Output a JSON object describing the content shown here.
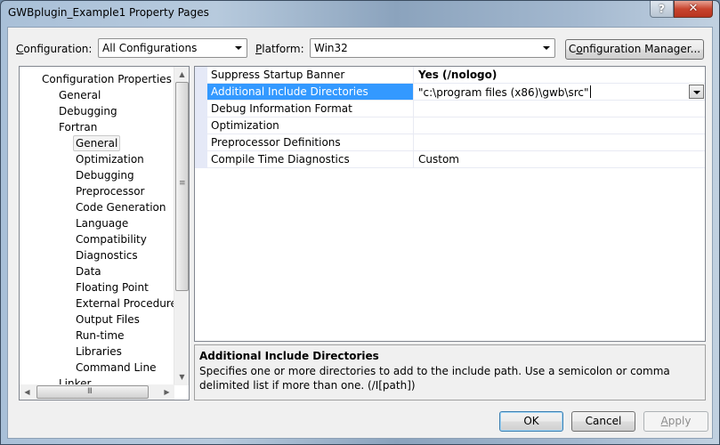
{
  "window": {
    "title": "GWBplugin_Example1 Property Pages",
    "help_button": "?",
    "close_button": "✕"
  },
  "toolbar": {
    "configuration_label_prefix": "",
    "configuration_label_accel": "C",
    "configuration_label_rest": "onfiguration:",
    "configuration_value": "All Configurations",
    "platform_label_accel": "P",
    "platform_label_rest": "latform:",
    "platform_value": "Win32",
    "config_manager_pre": "C",
    "config_manager_accel": "o",
    "config_manager_rest": "nfiguration Manager..."
  },
  "tree": {
    "items": [
      {
        "label": "Configuration Properties",
        "level": 0
      },
      {
        "label": "General",
        "level": 1
      },
      {
        "label": "Debugging",
        "level": 1
      },
      {
        "label": "Fortran",
        "level": 1
      },
      {
        "label": "General",
        "level": 2,
        "selected": true
      },
      {
        "label": "Optimization",
        "level": 2
      },
      {
        "label": "Debugging",
        "level": 2
      },
      {
        "label": "Preprocessor",
        "level": 2
      },
      {
        "label": "Code Generation",
        "level": 2
      },
      {
        "label": "Language",
        "level": 2
      },
      {
        "label": "Compatibility",
        "level": 2
      },
      {
        "label": "Diagnostics",
        "level": 2
      },
      {
        "label": "Data",
        "level": 2
      },
      {
        "label": "Floating Point",
        "level": 2
      },
      {
        "label": "External Procedures",
        "level": 2
      },
      {
        "label": "Output Files",
        "level": 2
      },
      {
        "label": "Run-time",
        "level": 2
      },
      {
        "label": "Libraries",
        "level": 2
      },
      {
        "label": "Command Line",
        "level": 2
      },
      {
        "label": "Linker",
        "level": 1
      }
    ],
    "scroll_up": "▲",
    "scroll_down": "▼",
    "scroll_left": "◀",
    "scroll_right": "▶",
    "vgrip": "≡",
    "hgrip": "III"
  },
  "properties": {
    "rows": [
      {
        "name": "Suppress Startup Banner",
        "value": "Yes (/nologo)",
        "bold": true
      },
      {
        "name": "Additional Include Directories",
        "value": "\"c:\\program files (x86)\\gwb\\src\"",
        "selected": true,
        "editing": true
      },
      {
        "name": "Debug Information Format",
        "value": ""
      },
      {
        "name": "Optimization",
        "value": ""
      },
      {
        "name": "Preprocessor Definitions",
        "value": ""
      },
      {
        "name": "Compile Time Diagnostics",
        "value": "Custom"
      }
    ]
  },
  "description": {
    "title": "Additional Include Directories",
    "text": "Specifies one or more directories to add to the include path. Use a semicolon or comma delimited list if more than one. (/I[path])"
  },
  "buttons": {
    "ok": "OK",
    "cancel": "Cancel",
    "apply_accel": "A",
    "apply_rest": "pply"
  },
  "colors": {
    "selection": "#3399ff",
    "close_red": "#c8452f"
  }
}
